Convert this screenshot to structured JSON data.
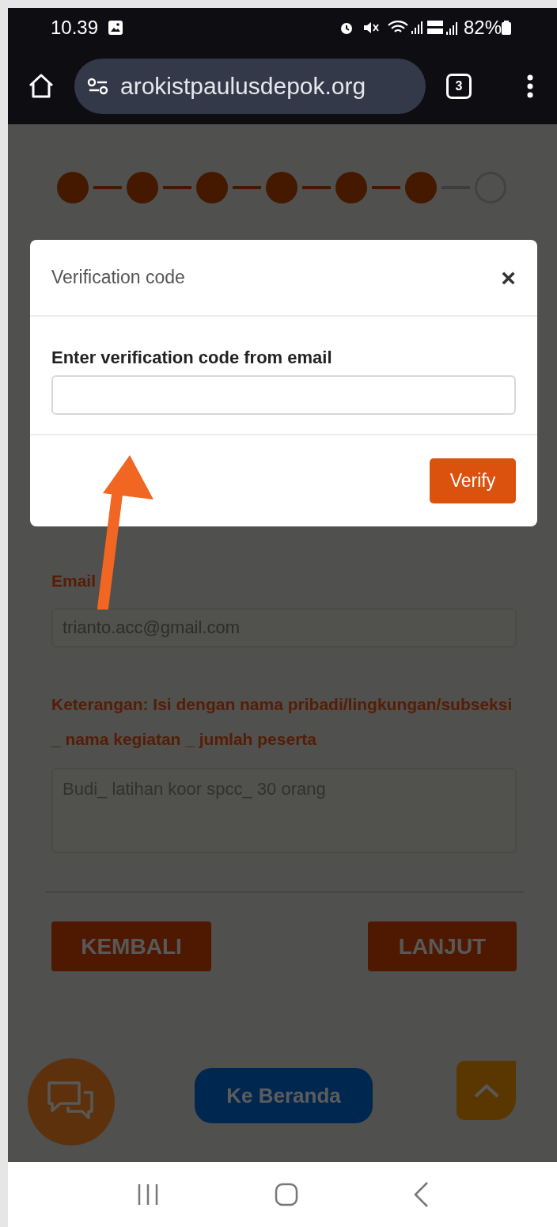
{
  "status_bar": {
    "time": "10.39",
    "battery": "82%"
  },
  "browser": {
    "url": "arokistpaulusdepok.org",
    "tab_count": "3"
  },
  "stepper": [
    {
      "done": true
    },
    {
      "done": true
    },
    {
      "done": true
    },
    {
      "done": true
    },
    {
      "done": true
    },
    {
      "done": true
    },
    {
      "done": false
    }
  ],
  "form": {
    "fields": [
      {
        "kind": "input",
        "label": "Email",
        "value": "trianto.acc@gmail.com"
      },
      {
        "kind": "textarea",
        "label": "Keterangan: Isi dengan nama pribadi/lingkungan/subseksi _ nama kegiatan _ jumlah peserta",
        "placeholder": "Budi_ latihan koor spcc_ 30 orang"
      }
    ],
    "buttons": [
      "KEMBALI",
      "LANJUT"
    ]
  },
  "home_button": "Ke Beranda",
  "dialog": {
    "title": "Verification code",
    "close": "×",
    "label": "Enter verification code from email",
    "submit": "Verify"
  }
}
